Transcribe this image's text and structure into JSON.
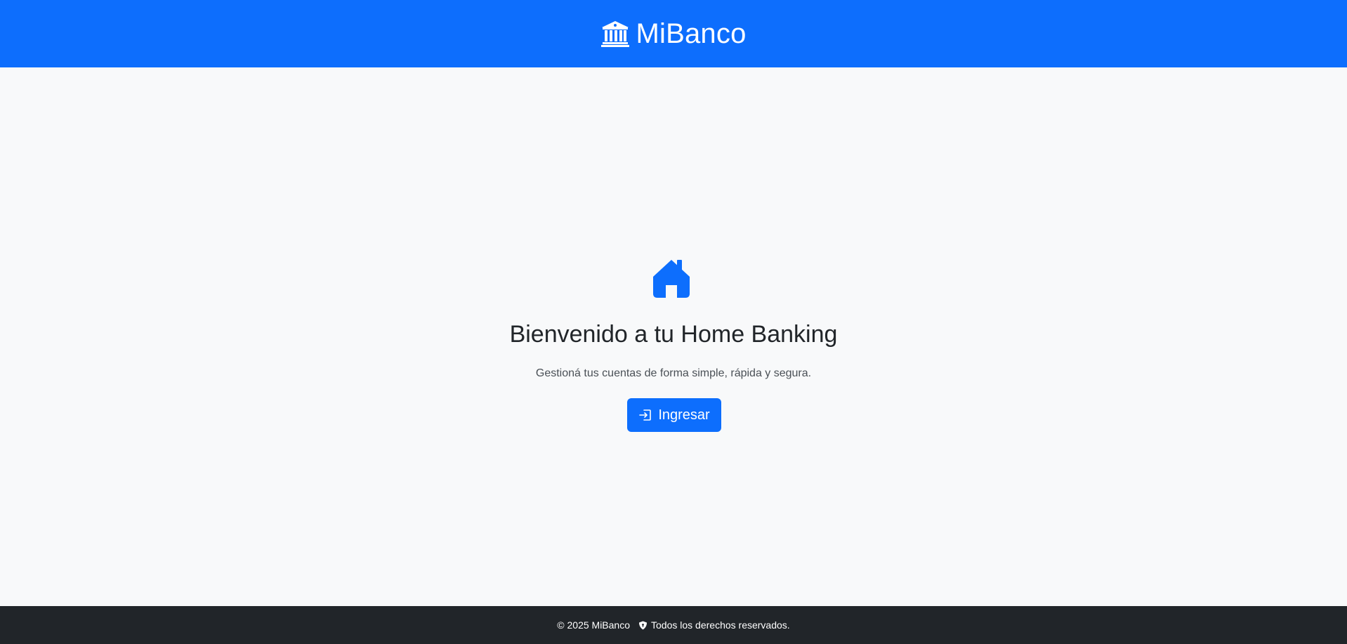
{
  "header": {
    "brand_name": "MiBanco",
    "brand_icon": "bank-icon",
    "background_color": "#0d6efd"
  },
  "hero": {
    "icon": "house-icon",
    "title": "Bienvenido a tu Home Banking",
    "subtitle": "Gestioná tus cuentas de forma simple, rápida y segura.",
    "login_button": {
      "label": "Ingresar",
      "icon": "login-icon"
    },
    "accent_color": "#0d6efd"
  },
  "footer": {
    "copyright": "© 2025 MiBanco",
    "rights_icon": "shield-icon",
    "rights_text": "Todos los derechos reservados.",
    "background_color": "#212529"
  }
}
